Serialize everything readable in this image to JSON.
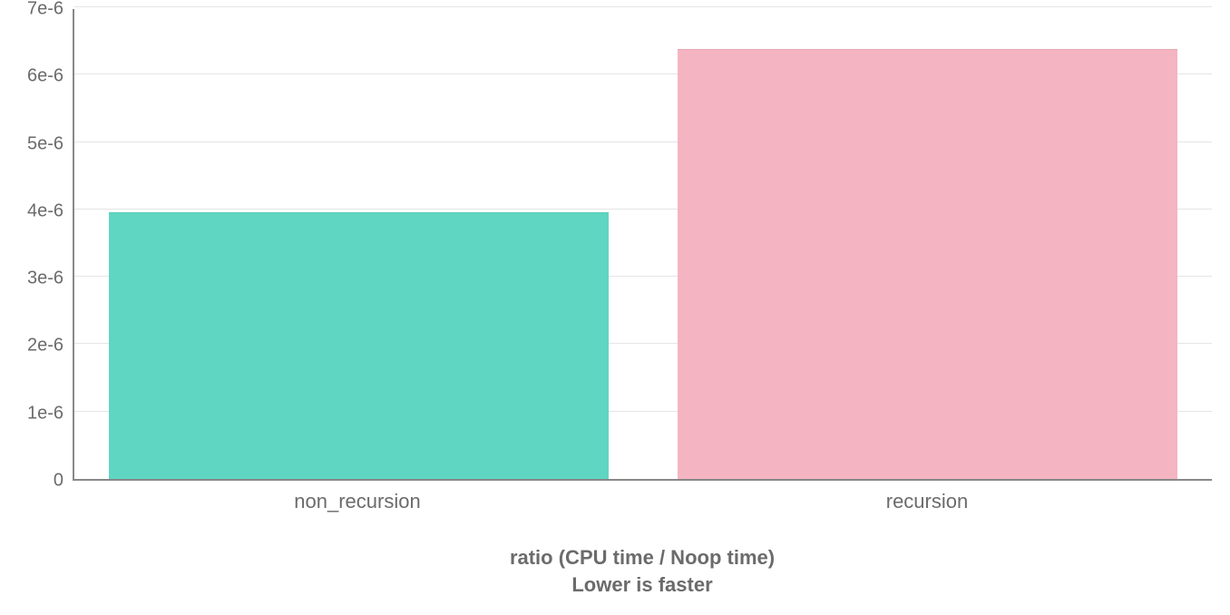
{
  "chart_data": {
    "type": "bar",
    "categories": [
      "non_recursion",
      "recursion"
    ],
    "values": [
      3.97e-06,
      6.4e-06
    ],
    "colors": [
      "#5fd6c2",
      "#f5b4c2"
    ],
    "title": "",
    "xlabel_line1": "ratio (CPU time / Noop time)",
    "xlabel_line2": "Lower is faster",
    "ylabel": "",
    "ylim": [
      0,
      7e-06
    ],
    "y_ticks": [
      0,
      1e-06,
      2e-06,
      3e-06,
      4e-06,
      5e-06,
      6e-06,
      7e-06
    ],
    "y_tick_labels": [
      "0",
      "1e-6",
      "2e-6",
      "3e-6",
      "4e-6",
      "5e-6",
      "6e-6",
      "7e-6"
    ]
  }
}
